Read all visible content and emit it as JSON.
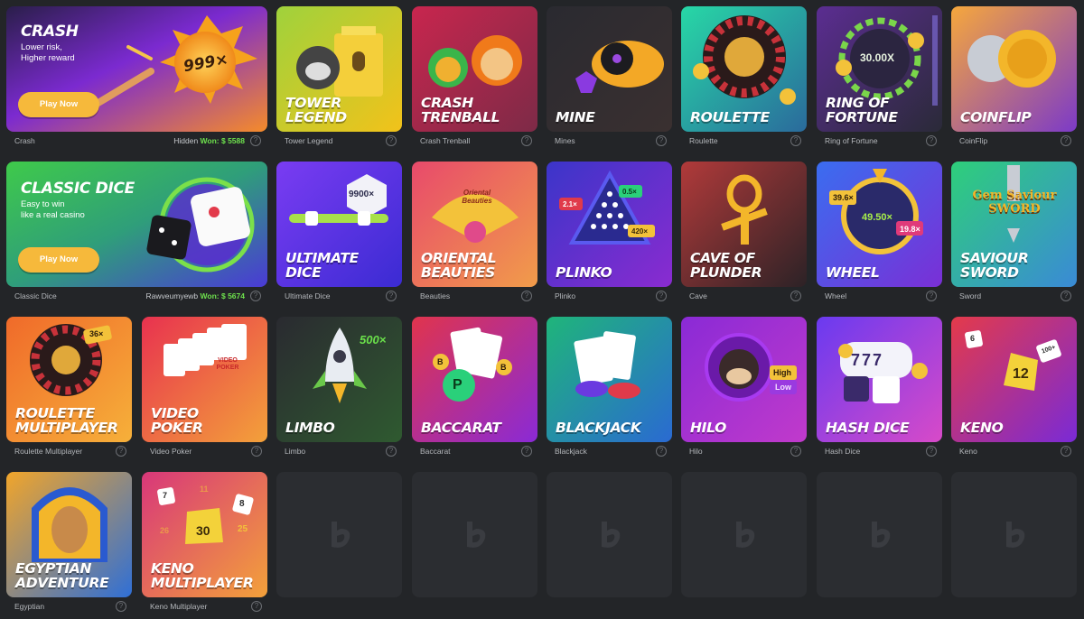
{
  "featured": [
    {
      "title": "CRASH",
      "subtitle": "Lower risk,\nHigher reward",
      "button": "Play Now",
      "badge": "999×",
      "caption": "Crash",
      "winner": "Hidden",
      "won": "Won: $ 5588"
    },
    {
      "title": "CLASSIC DICE",
      "subtitle": "Easy to win\nlike a real casino",
      "button": "Play Now",
      "caption": "Classic Dice",
      "winner": "Rawveumyewb",
      "won": "Won: $ 5674"
    }
  ],
  "row1": [
    {
      "title": "TOWER\nLEGEND",
      "caption": "Tower Legend",
      "colors": [
        "#9fd23c",
        "#f2c21a"
      ]
    },
    {
      "title": "CRASH\nTRENBALL",
      "caption": "Crash Trenball",
      "colors": [
        "#d8375a",
        "#7d2a47"
      ]
    },
    {
      "title": "MINE",
      "caption": "Mines",
      "colors": [
        "#2c2c32",
        "#e0a430"
      ]
    },
    {
      "title": "ROULETTE",
      "caption": "Roulette",
      "colors": [
        "#27d8a6",
        "#2a7a9c"
      ]
    },
    {
      "title": "RING OF\nFORTUNE",
      "caption": "Ring of Fortune",
      "badge": "30.00X",
      "colors": [
        "#5b2d91",
        "#3a2a4a"
      ]
    },
    {
      "title": "COINFLIP",
      "caption": "CoinFlip",
      "colors": [
        "#f6a73c",
        "#7c3ac8"
      ]
    }
  ],
  "row2": [
    {
      "title": "ULTIMATE\nDICE",
      "caption": "Ultimate Dice",
      "badge": "9900×",
      "colors": [
        "#6a3cf2",
        "#3b2bd3"
      ]
    },
    {
      "title": "ORIENTAL\nBEAUTIES",
      "caption": "Beauties",
      "badge": "Oriental Beauties",
      "colors": [
        "#e84a6b",
        "#f19c4a"
      ]
    },
    {
      "title": "PLINKO",
      "caption": "Plinko",
      "badges": [
        "2.1×",
        "0.5×",
        "420×"
      ],
      "colors": [
        "#3b35c9",
        "#8a2bd0"
      ]
    },
    {
      "title": "CAVE OF\nPLUNDER",
      "caption": "Cave",
      "colors": [
        "#b13a3a",
        "#2c2226"
      ]
    },
    {
      "title": "WHEEL",
      "caption": "Wheel",
      "badges": [
        "39.6×",
        "49.50×",
        "19.8×"
      ],
      "colors": [
        "#3a6df0",
        "#7a2fd6"
      ]
    },
    {
      "title": "SAVIOUR\nSWORD",
      "caption": "Sword",
      "badge": "Gem Saviour SWORD",
      "colors": [
        "#2ecf7a",
        "#3a8ad6"
      ]
    }
  ],
  "row3": [
    {
      "title": "ROULETTE\nMULTIPLAYER",
      "caption": "Roulette Multiplayer",
      "badge": "36×",
      "colors": [
        "#f06a2a",
        "#f6b03a"
      ]
    },
    {
      "title": "VIDEO\nPOKER",
      "caption": "Video Poker",
      "badge": "VIDEO POKER",
      "colors": [
        "#e8324f",
        "#f3a13a"
      ]
    },
    {
      "title": "LIMBO",
      "caption": "Limbo",
      "badge": "500×",
      "colors": [
        "#2a2a30",
        "#3a5a38"
      ]
    },
    {
      "title": "BACCARAT",
      "caption": "Baccarat",
      "badges": [
        "B",
        "P",
        "B"
      ],
      "colors": [
        "#e0344d",
        "#8a2ad6"
      ]
    },
    {
      "title": "BLACKJACK",
      "caption": "Blackjack",
      "colors": [
        "#1fb57a",
        "#2a6ad2"
      ]
    },
    {
      "title": "HILO",
      "caption": "Hilo",
      "badges": [
        "High",
        "Low"
      ],
      "colors": [
        "#8a2ad6",
        "#c13acb"
      ]
    },
    {
      "title": "HASH DICE",
      "caption": "Hash Dice",
      "badge": "777",
      "colors": [
        "#6a3af0",
        "#d84ac8"
      ]
    },
    {
      "title": "KENO",
      "caption": "Keno",
      "badges": [
        "6",
        "12",
        "100+"
      ],
      "colors": [
        "#e43a4a",
        "#7a2ad6"
      ]
    }
  ],
  "row4": [
    {
      "title": "EGYPTIAN\nADVENTURE",
      "caption": "Egyptian",
      "colors": [
        "#f1a52a",
        "#2f6fd6"
      ]
    },
    {
      "title": "KENO\nMULTIPLAYER",
      "caption": "Keno Multiplayer",
      "badges": [
        "7",
        "11",
        "8",
        "26",
        "30",
        "25"
      ],
      "colors": [
        "#d8377a",
        "#f3a13a"
      ]
    }
  ],
  "help_icon": "?",
  "placeholder_icon": "bc-logo-icon"
}
